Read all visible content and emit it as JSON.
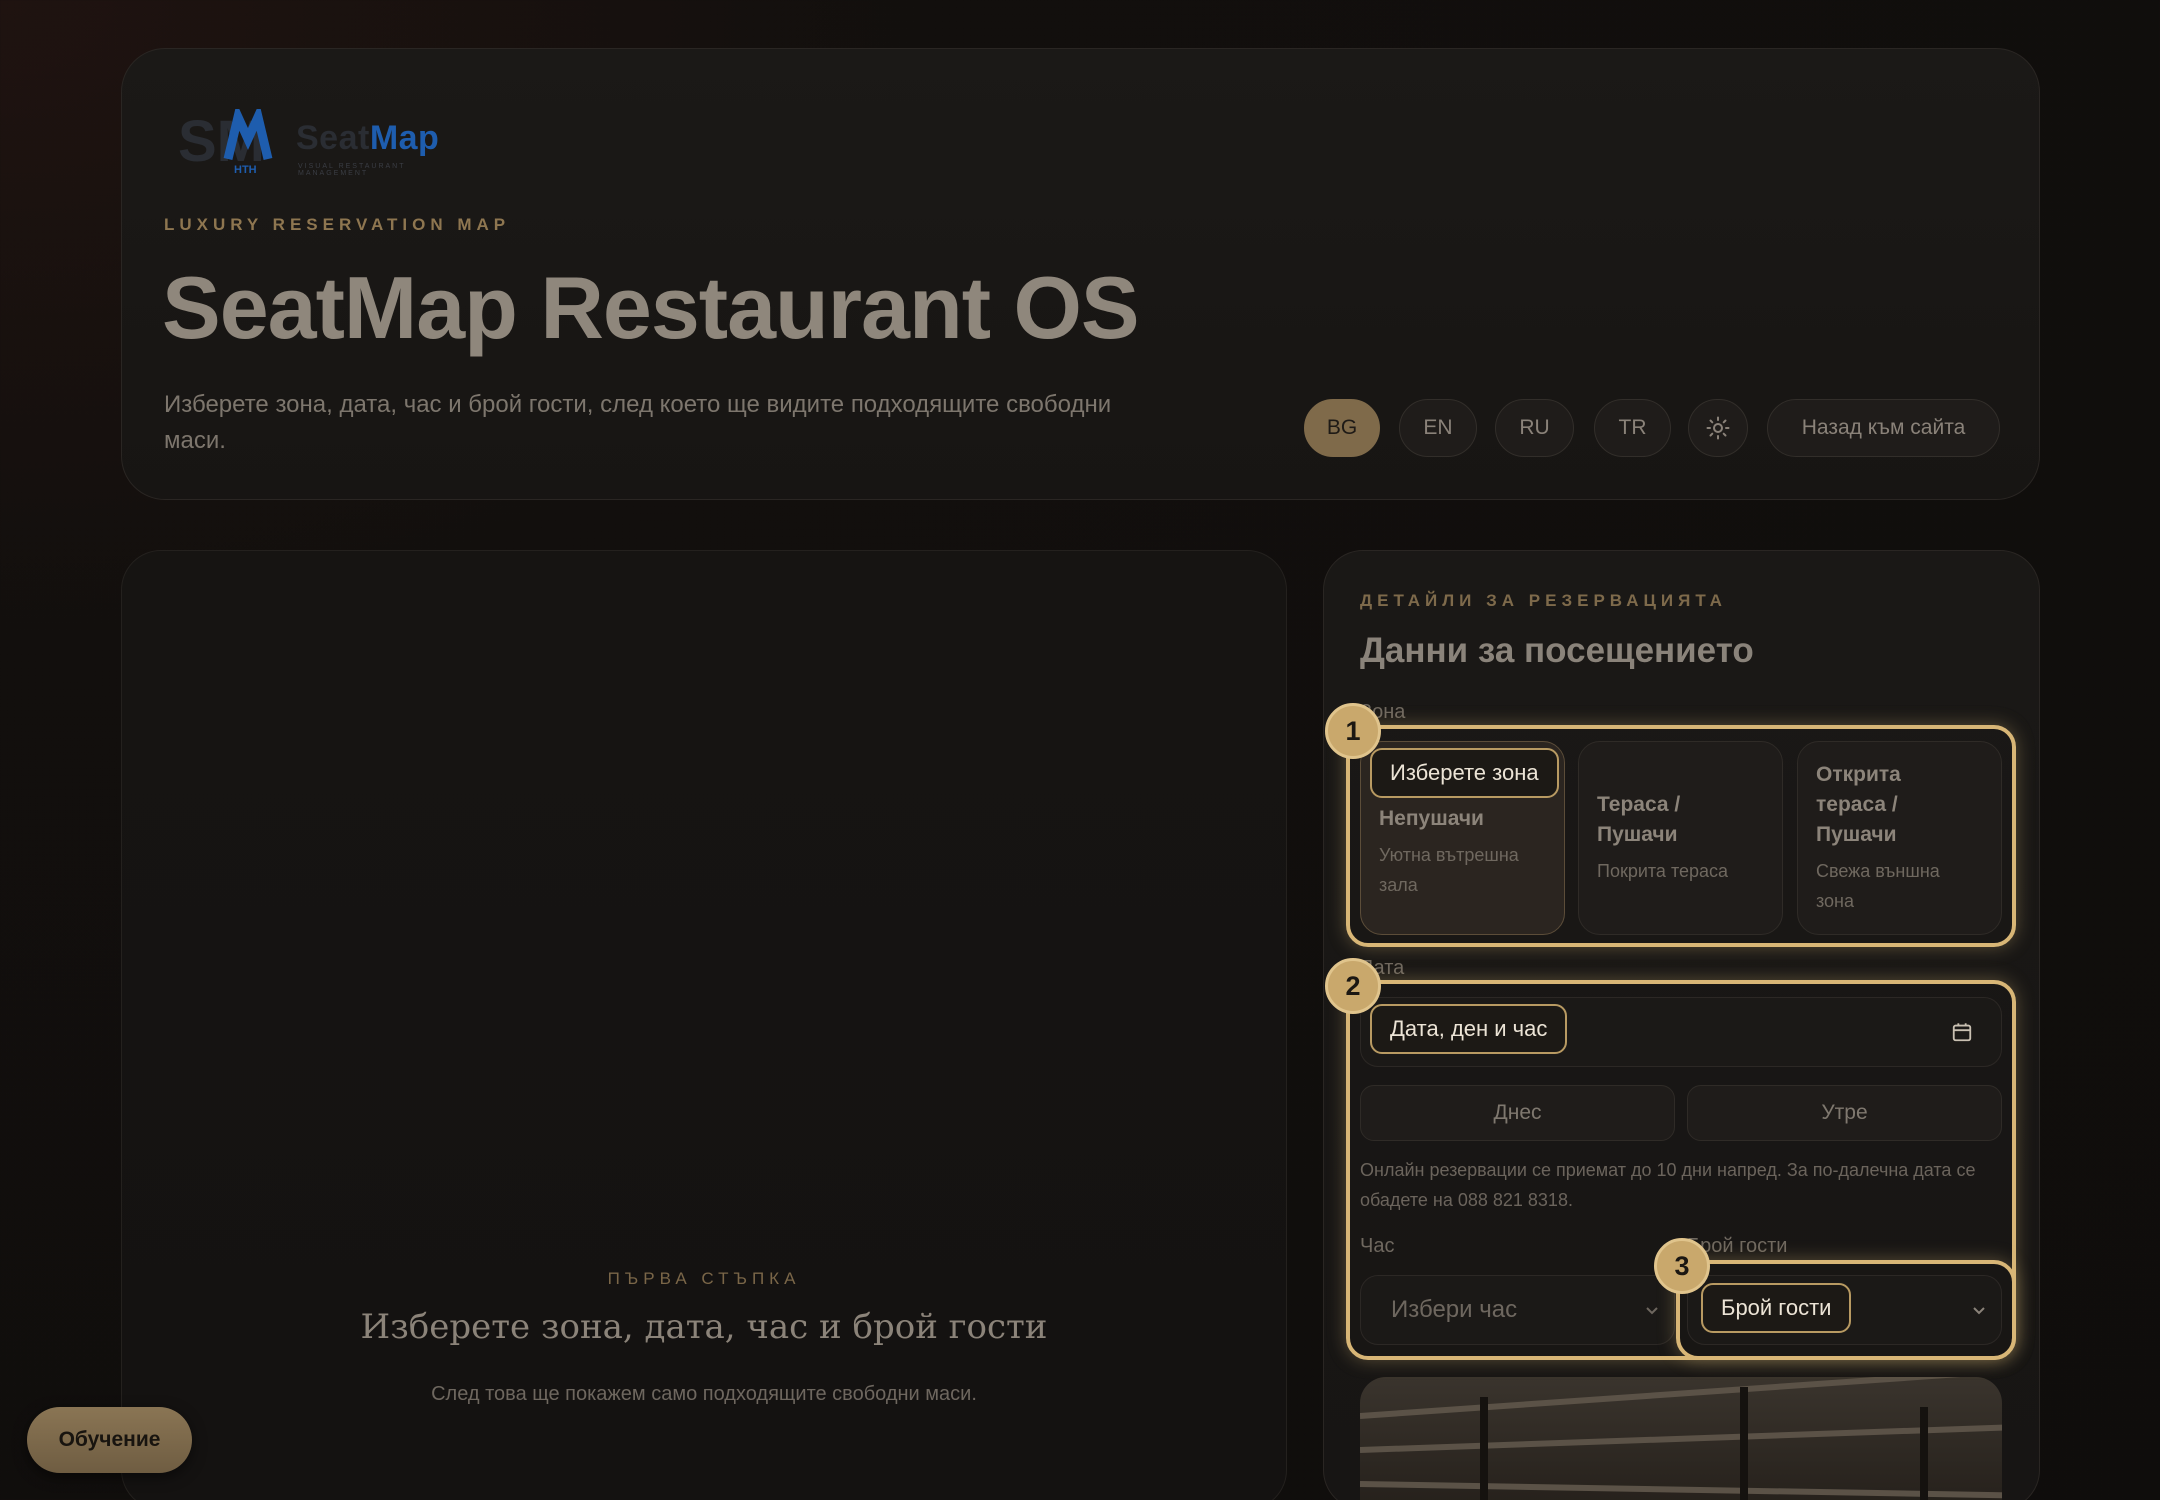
{
  "brand": {
    "logo_mark": "SM",
    "logo_sub": "HTH",
    "logo_word_a": "Seat",
    "logo_word_b": "Map",
    "logo_tagline": "VISUAL RESTAURANT MANAGEMENT"
  },
  "hero": {
    "eyebrow": "LUXURY RESERVATION MAP",
    "title": "SeatMap Restaurant OS",
    "subtitle": "Изберете зона, дата, час и брой гости, след което ще видите подходящите свободни маси."
  },
  "header_controls": {
    "languages": [
      "BG",
      "EN",
      "RU",
      "TR"
    ],
    "active_language": "BG",
    "theme_icon": "sun-icon",
    "back_label": "Назад към сайта"
  },
  "empty_state": {
    "label": "ПЪРВА СТЪПКА",
    "title": "Изберете зона, дата, час и брой гости",
    "subtitle": "След това ще покажем само подходящите свободни маси."
  },
  "form": {
    "eyebrow": "ДЕТАЙЛИ ЗА РЕЗЕРВАЦИЯТА",
    "title": "Данни за посещението",
    "zone_label": "Зона",
    "zones": [
      {
        "name": "Непушачи",
        "desc": "Уютна вътрешна зала"
      },
      {
        "name": "Тераса / Пушачи",
        "desc": "Покрита тераса"
      },
      {
        "name": "Открита тераса / Пушачи",
        "desc": "Свежа външна зона"
      }
    ],
    "date_label": "Дата",
    "today_label": "Днес",
    "tomorrow_label": "Утре",
    "note": "Онлайн резервации се приемат до 10 дни напред. За по-далечна дата се обадете на 088 821 8318.",
    "time_label": "Час",
    "time_placeholder": "Избери час",
    "guests_label": "Брой гости"
  },
  "tour": {
    "steps": [
      "1",
      "2",
      "3"
    ],
    "tip_zone": "Изберете зона",
    "tip_date": "Дата, ден и час",
    "tip_guests": "Брой гости",
    "button_label": "Обучение"
  },
  "colors": {
    "accent": "#c9a86c",
    "highlight": "#d8b676",
    "brand_blue": "#1e5dae"
  }
}
